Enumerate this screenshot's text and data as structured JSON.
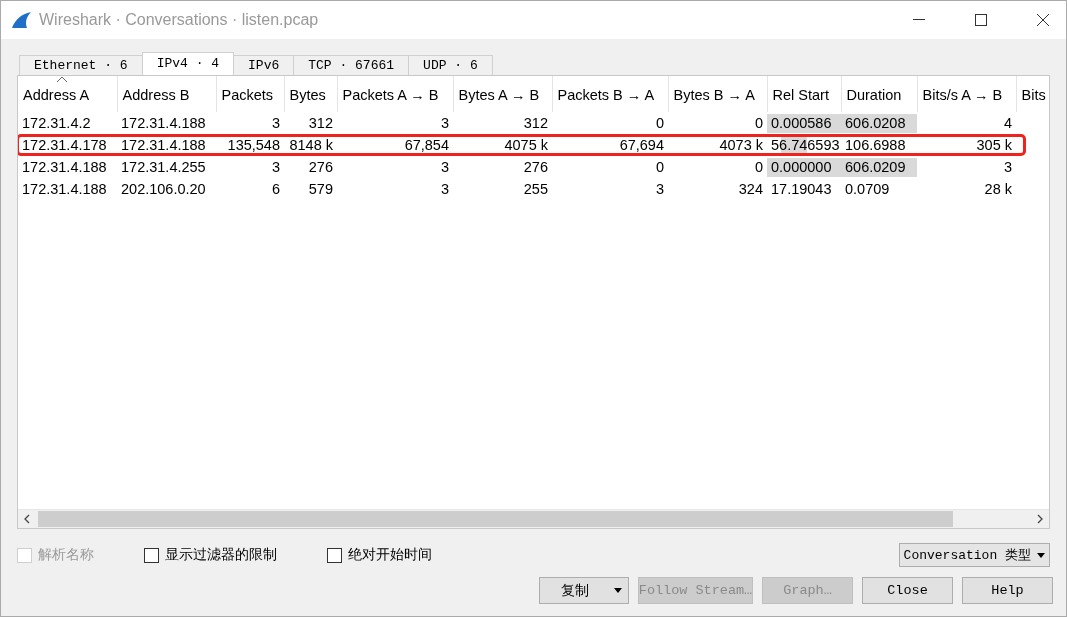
{
  "window": {
    "title": "Wireshark · Conversations · listen.pcap"
  },
  "tabs": [
    {
      "label": "Ethernet · 6",
      "selected": false
    },
    {
      "label": "IPv4 · 4",
      "selected": true
    },
    {
      "label": "IPv6",
      "selected": false
    },
    {
      "label": "TCP · 67661",
      "selected": false
    },
    {
      "label": "UDP · 6",
      "selected": false
    }
  ],
  "table": {
    "columns": [
      {
        "label": "Address A",
        "sorted": true
      },
      {
        "label": "Address B",
        "sorted": false
      },
      {
        "label": "Packets",
        "sorted": false
      },
      {
        "label": "Bytes",
        "sorted": false
      },
      {
        "label": "Packets A → B",
        "sorted": false
      },
      {
        "label": "Bytes A → B",
        "sorted": false
      },
      {
        "label": "Packets B → A",
        "sorted": false
      },
      {
        "label": "Bytes B → A",
        "sorted": false
      },
      {
        "label": "Rel Start",
        "sorted": false
      },
      {
        "label": "Duration",
        "sorted": false
      },
      {
        "label": "Bits/s A → B",
        "sorted": false
      },
      {
        "label": "Bits",
        "sorted": false
      }
    ],
    "rows": [
      {
        "annotated": false,
        "cells": [
          "172.31.4.2",
          "172.31.4.188",
          "3",
          "312",
          "3",
          "312",
          "0",
          "0",
          "0.000586",
          "606.0208",
          "4"
        ]
      },
      {
        "annotated": true,
        "cells": [
          "172.31.4.178",
          "172.31.4.188",
          "135,548",
          "8148 k",
          "67,854",
          "4075 k",
          "67,694",
          "4073 k",
          "56.746593",
          "106.6988",
          "305 k"
        ]
      },
      {
        "annotated": false,
        "cells": [
          "172.31.4.188",
          "172.31.4.255",
          "3",
          "276",
          "3",
          "276",
          "0",
          "0",
          "0.000000",
          "606.0209",
          "3"
        ]
      },
      {
        "annotated": false,
        "cells": [
          "172.31.4.188",
          "202.106.0.20",
          "6",
          "579",
          "3",
          "255",
          "3",
          "324",
          "17.19043",
          "0.0709",
          "28 k"
        ]
      }
    ]
  },
  "options": [
    {
      "label": "解析名称",
      "checked": false,
      "disabled": true
    },
    {
      "label": "显示过滤器的限制",
      "checked": false,
      "disabled": false
    },
    {
      "label": "绝对开始时间",
      "checked": false,
      "disabled": false
    }
  ],
  "type_dropdown": {
    "label": "Conversation 类型"
  },
  "buttons": [
    {
      "label": "复制",
      "kind": "split",
      "disabled": false
    },
    {
      "label": "Follow Stream…",
      "kind": "plain",
      "disabled": true
    },
    {
      "label": "Graph…",
      "kind": "plain",
      "disabled": true
    },
    {
      "label": "Close",
      "kind": "plain",
      "disabled": false
    },
    {
      "label": "Help",
      "kind": "plain",
      "disabled": false
    }
  ]
}
